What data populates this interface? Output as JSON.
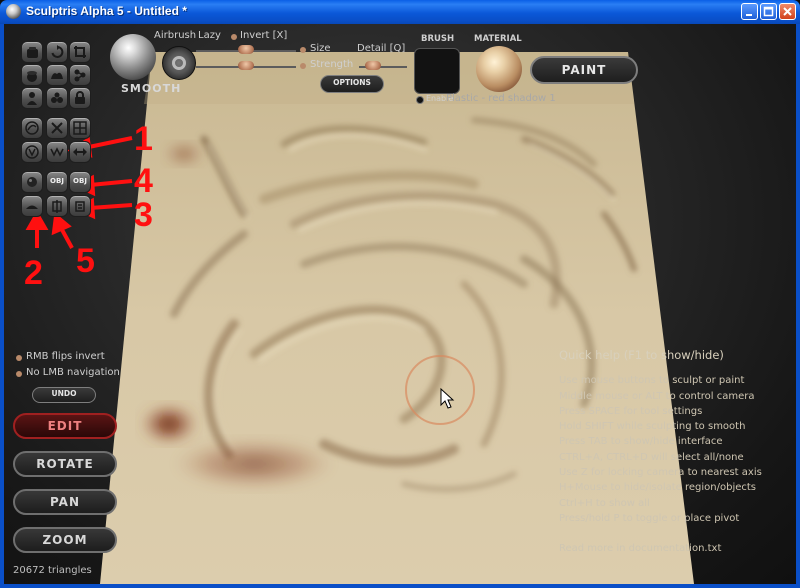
{
  "window": {
    "title": "Sculptris Alpha 5 - Untitled *",
    "controls": [
      "minimize",
      "maximize",
      "close"
    ]
  },
  "tools": {
    "top_grid_icons": [
      "cube-icon",
      "rotate-icon",
      "crop-icon",
      "sphere-icon",
      "blob-icon",
      "molecule-icon",
      "person-icon",
      "bubbles-icon",
      "lock-icon"
    ],
    "mid_grid_icons": [
      "curve-icon",
      "cross-icon",
      "grid-icon",
      "twist-icon",
      "wave-icon",
      "arrows-icon"
    ],
    "import_icons": [
      "ball-icon",
      "obj-import-icon",
      "obj-export-icon"
    ],
    "import_labels": [
      "",
      "OBJ",
      "OBJ"
    ],
    "bottom_icons": [
      "plane-icon",
      "symmetry-icon",
      "mirror-icon"
    ]
  },
  "brush": {
    "name": "SMOOTH",
    "airbrush_label": "Airbrush",
    "lazy_label": "Lazy",
    "invert_label": "Invert [X]",
    "size_label": "Size",
    "strength_label": "Strength",
    "detail_label": "Detail [Q]",
    "options_label": "OPTIONS",
    "size_value": 0.5,
    "strength_value": 0.5,
    "detail_value": 0.3
  },
  "brush_panel": {
    "brush_title": "BRUSH",
    "material_title": "MATERIAL",
    "enable_label": "Enable",
    "material_name": "Plastic - red shadow 1"
  },
  "paint_button": "PAINT",
  "options": {
    "rmb_flips_invert": "RMB flips invert",
    "no_lmb_navigation": "No LMB navigation"
  },
  "undo_label": "UNDO",
  "nav_buttons": [
    "EDIT",
    "ROTATE",
    "PAN",
    "ZOOM"
  ],
  "active_nav": "EDIT",
  "status": {
    "triangles": "20672 triangles"
  },
  "quick_help": {
    "title": "Quick help (F1 to show/hide)",
    "lines": [
      "Use mouse buttons to sculpt or paint",
      "Middle mouse or ALT to control camera",
      "Press SPACE for tool settings",
      "Hold SHIFT while sculpting to smooth",
      "Press TAB to show/hide interface",
      "CTRL+A, CTRL+D will select all/none",
      "Use Z for locking camera to nearest axis",
      "H+Mouse to hide/isolate region/objects",
      "Ctrl+H to show all",
      "Press/hold P to toggle or place pivot"
    ],
    "footer": "Read more in documentation.txt"
  },
  "annotations": {
    "color": "#ff1010",
    "labels": [
      "1",
      "4",
      "3",
      "2",
      "5"
    ]
  },
  "colors": {
    "sculpt_surface": "#d9c9a8",
    "red_shadow": "#7a2a1a",
    "edit_active": "#a02020"
  }
}
